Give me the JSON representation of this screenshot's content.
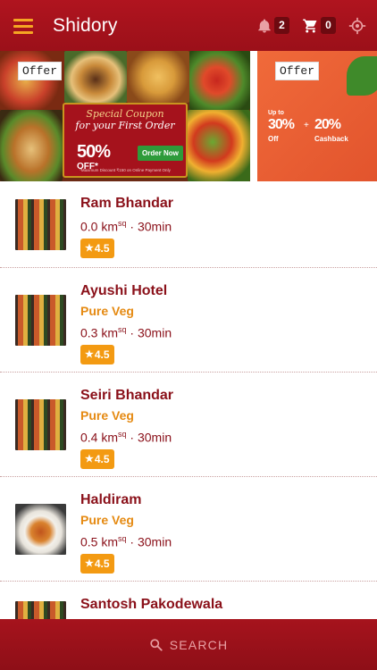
{
  "app": {
    "title": "Shidory"
  },
  "header": {
    "notifications_count": "2",
    "cart_count": "0"
  },
  "banners": [
    {
      "tag": "Offer",
      "coupon_title": "Special Coupon",
      "coupon_sub": "for your First Order",
      "discount": "50%",
      "discount_suffix": "OFF*",
      "button": "Order Now",
      "note": "*Maximum Discount ₹150 on Online Payment Only"
    },
    {
      "tag": "Offer",
      "upto": "Up to",
      "pct1": "30%",
      "pct1_suffix": "Off",
      "plus": "+",
      "pct2": "20%",
      "pct2_suffix": "Cashback"
    }
  ],
  "restaurants": [
    {
      "name": "Ram Bhandar",
      "tag": "",
      "distance": "0.0 km",
      "unit_sup": "sq",
      "time": "· 30min",
      "rating": "4.5",
      "thumb": "buffet"
    },
    {
      "name": "Ayushi Hotel",
      "tag": "Pure Veg",
      "distance": "0.3 km",
      "unit_sup": "sq",
      "time": "· 30min",
      "rating": "4.5",
      "thumb": "buffet"
    },
    {
      "name": "Seiri Bhandar",
      "tag": "Pure Veg",
      "distance": "0.4 km",
      "unit_sup": "sq",
      "time": "· 30min",
      "rating": "4.5",
      "thumb": "buffet"
    },
    {
      "name": "Haldiram",
      "tag": "Pure Veg",
      "distance": "0.5 km",
      "unit_sup": "sq",
      "time": "· 30min",
      "rating": "4.5",
      "thumb": "bowl"
    },
    {
      "name": "Santosh Pakodewala",
      "tag": "",
      "distance": "",
      "unit_sup": "",
      "time": "",
      "rating": "",
      "thumb": "buffet"
    }
  ],
  "bottom": {
    "search_label": "SEARCH"
  },
  "colors": {
    "primary": "#a6131d",
    "accent": "#f39a12",
    "text_dark_red": "#8a1019"
  },
  "icons": {
    "menu": "hamburger-icon",
    "notifications": "bell-icon",
    "cart": "cart-icon",
    "location": "crosshair-icon",
    "search": "search-icon",
    "rating": "star-icon"
  }
}
